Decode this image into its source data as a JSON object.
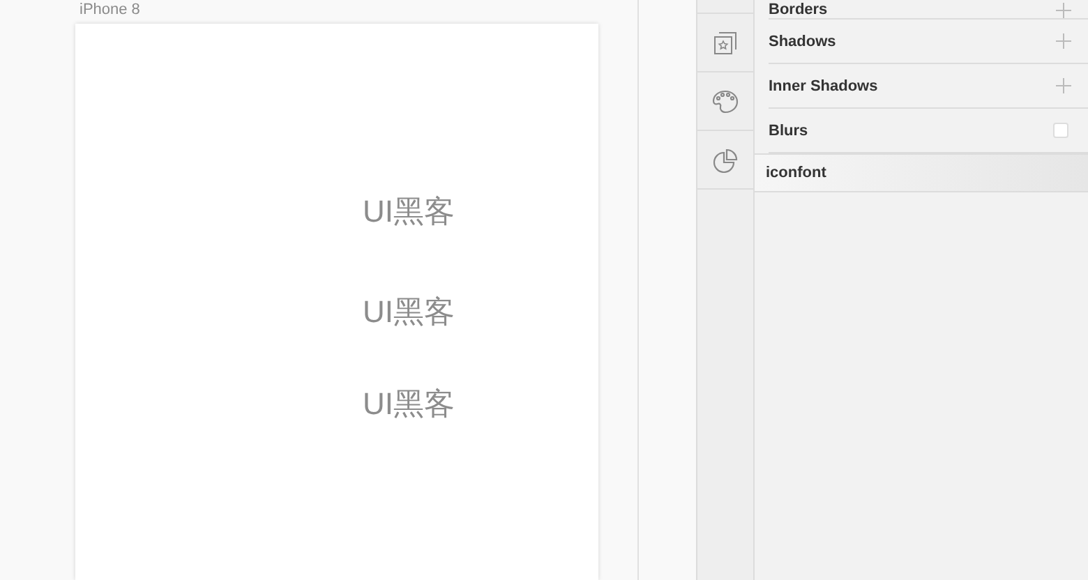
{
  "canvas": {
    "artboard": {
      "label": "iPhone 8",
      "texts": [
        "UI黑客",
        "UI黑客",
        "UI黑客"
      ]
    }
  },
  "inspector": {
    "rows": [
      {
        "label": "Borders",
        "kind": "add"
      },
      {
        "label": "Shadows",
        "kind": "add"
      },
      {
        "label": "Inner Shadows",
        "kind": "add"
      },
      {
        "label": "Blurs",
        "kind": "checkbox",
        "checked": false
      }
    ],
    "section": {
      "title": "iconfont"
    }
  }
}
